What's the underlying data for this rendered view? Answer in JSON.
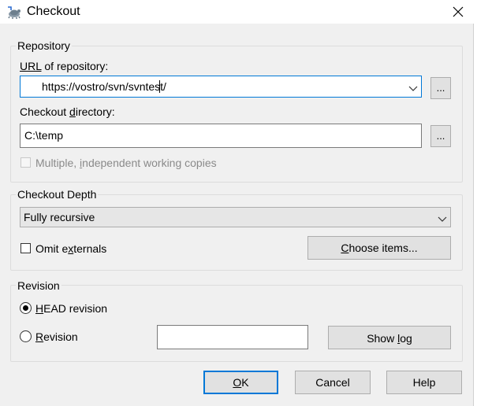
{
  "window": {
    "title": "Checkout",
    "close_icon": "close-icon",
    "app_icon": "tortoisesvn-icon"
  },
  "repository": {
    "group_label": "Repository",
    "url_label_prefix": "URL",
    "url_label_rest": " of repository:",
    "url_value": "https://vostro/svn/svntest/",
    "url_browse": "...",
    "dir_label_prefix": "Checkout ",
    "dir_label_access": "d",
    "dir_label_rest": "irectory:",
    "dir_value": "C:\\temp",
    "dir_browse": "...",
    "multiple_prefix": "Multiple, ",
    "multiple_access": "i",
    "multiple_rest": "ndependent working copies",
    "multiple_checked": false,
    "multiple_enabled": false
  },
  "depth": {
    "group_label": "Checkout Depth",
    "selected": "Fully recursive",
    "omit_prefix": "Omit e",
    "omit_access": "x",
    "omit_rest": "ternals",
    "omit_checked": false,
    "choose_access": "C",
    "choose_rest": "hoose items..."
  },
  "revision": {
    "group_label": "Revision",
    "head_access": "H",
    "head_rest": "EAD revision",
    "head_checked": true,
    "rev_access": "R",
    "rev_rest": "evision",
    "rev_checked": false,
    "rev_value": "",
    "showlog_prefix": "Show ",
    "showlog_access": "l",
    "showlog_rest": "og"
  },
  "buttons": {
    "ok_access": "O",
    "ok_rest": "K",
    "cancel": "Cancel",
    "help": "Help"
  }
}
